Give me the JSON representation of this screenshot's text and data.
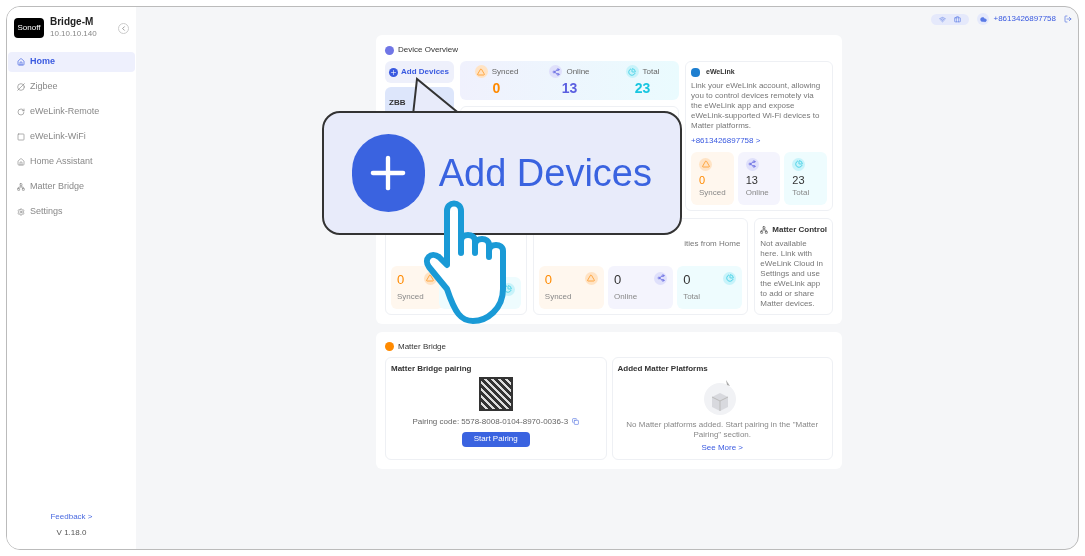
{
  "sidebar": {
    "brand_logo": "Sonoff",
    "device_name": "Bridge-M",
    "ip": "10.10.10.140",
    "items": [
      {
        "kind": "home",
        "label": "Home",
        "selected": true
      },
      {
        "kind": "zigbee",
        "label": "Zigbee",
        "selected": false
      },
      {
        "kind": "remote",
        "label": "eWeLink-Remote",
        "selected": false
      },
      {
        "kind": "wifi",
        "label": "eWeLink-WiFi",
        "selected": false
      },
      {
        "kind": "assistant",
        "label": "Home Assistant",
        "selected": false
      },
      {
        "kind": "matter",
        "label": "Matter Bridge",
        "selected": false
      },
      {
        "kind": "settings",
        "label": "Settings",
        "selected": false
      }
    ],
    "feedback": "Feedback >",
    "version": "V 1.18.0"
  },
  "top_bar": {
    "account": "+8613426897758"
  },
  "device_overview": {
    "title": "Device Overview",
    "add_button": "Add Devices",
    "zigbee_card_label": "ZBB",
    "summary": [
      {
        "kind": "synced",
        "label": "Synced",
        "value": "0"
      },
      {
        "kind": "online",
        "label": "Online",
        "value": "13"
      },
      {
        "kind": "total",
        "label": "Total",
        "value": "23"
      }
    ],
    "ewelink": {
      "title": "eWeLink",
      "description": "Link your eWeLink account, allowing you to control devices remotely via the eWeLink app and expose eWeLink-supported Wi-Fi devices to Matter platforms.",
      "account": "+8613426897758 >",
      "stats": [
        {
          "kind": "synced",
          "label": "Synced",
          "value": "0"
        },
        {
          "kind": "online",
          "label": "Online",
          "value": "13"
        },
        {
          "kind": "total",
          "label": "Total",
          "value": "23"
        }
      ]
    },
    "zigbee_stats": [
      {
        "kind": "synced",
        "label": "Synced",
        "value": "0"
      }
    ],
    "home_assistant": {
      "description_fragment": "ities from Home",
      "stats": [
        {
          "kind": "synced",
          "label": "Synced",
          "value": "0"
        },
        {
          "kind": "online",
          "label": "Online",
          "value": "0"
        },
        {
          "kind": "total",
          "label": "Total",
          "value": "0"
        }
      ]
    },
    "matter_control": {
      "title": "Matter Control",
      "description": "Not available here. Link with eWeLink Cloud in Settings and use the eWeLink app to add or share Matter devices."
    }
  },
  "matter_bridge": {
    "title": "Matter Bridge",
    "pairing": {
      "title": "Matter Bridge pairing",
      "code": "Pairing code: 5578-8008-0104-8970-0036-3",
      "button": "Start Pairing"
    },
    "platforms": {
      "title": "Added Matter Platforms",
      "empty_text": "No Matter platforms added. Start pairing in the \"Matter Pairing\" section.",
      "link": "See More >"
    }
  },
  "callout": {
    "label": "Add Devices"
  }
}
